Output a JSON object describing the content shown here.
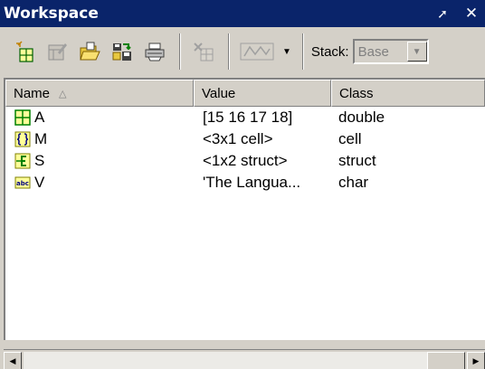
{
  "window": {
    "title": "Workspace",
    "undock_glyph": "➚",
    "close_glyph": "✕"
  },
  "toolbar": {
    "icons": [
      "new-variable-icon",
      "open-selection-icon",
      "load-data-icon",
      "save-icon",
      "print-icon",
      "delete-icon",
      "plot-icon"
    ],
    "stack_label": "Stack:",
    "stack_value": "Base"
  },
  "table": {
    "headers": {
      "name": "Name",
      "value": "Value",
      "class": "Class"
    },
    "sort_indicator": "△",
    "rows": [
      {
        "icon": "matrix-icon",
        "name": "A",
        "value": "[15 16 17 18]",
        "class": "double"
      },
      {
        "icon": "cell-icon",
        "name": "M",
        "value": "<3x1 cell>",
        "class": "cell"
      },
      {
        "icon": "struct-icon",
        "name": "S",
        "value": "<1x2 struct>",
        "class": "struct"
      },
      {
        "icon": "char-icon",
        "name": "V",
        "value": "'The Langua...",
        "class": "char"
      }
    ]
  },
  "colors": {
    "titlebar": "#0a246a",
    "icon_bg": "#ffff99",
    "icon_border": "#808000",
    "icon_green": "#008000"
  }
}
